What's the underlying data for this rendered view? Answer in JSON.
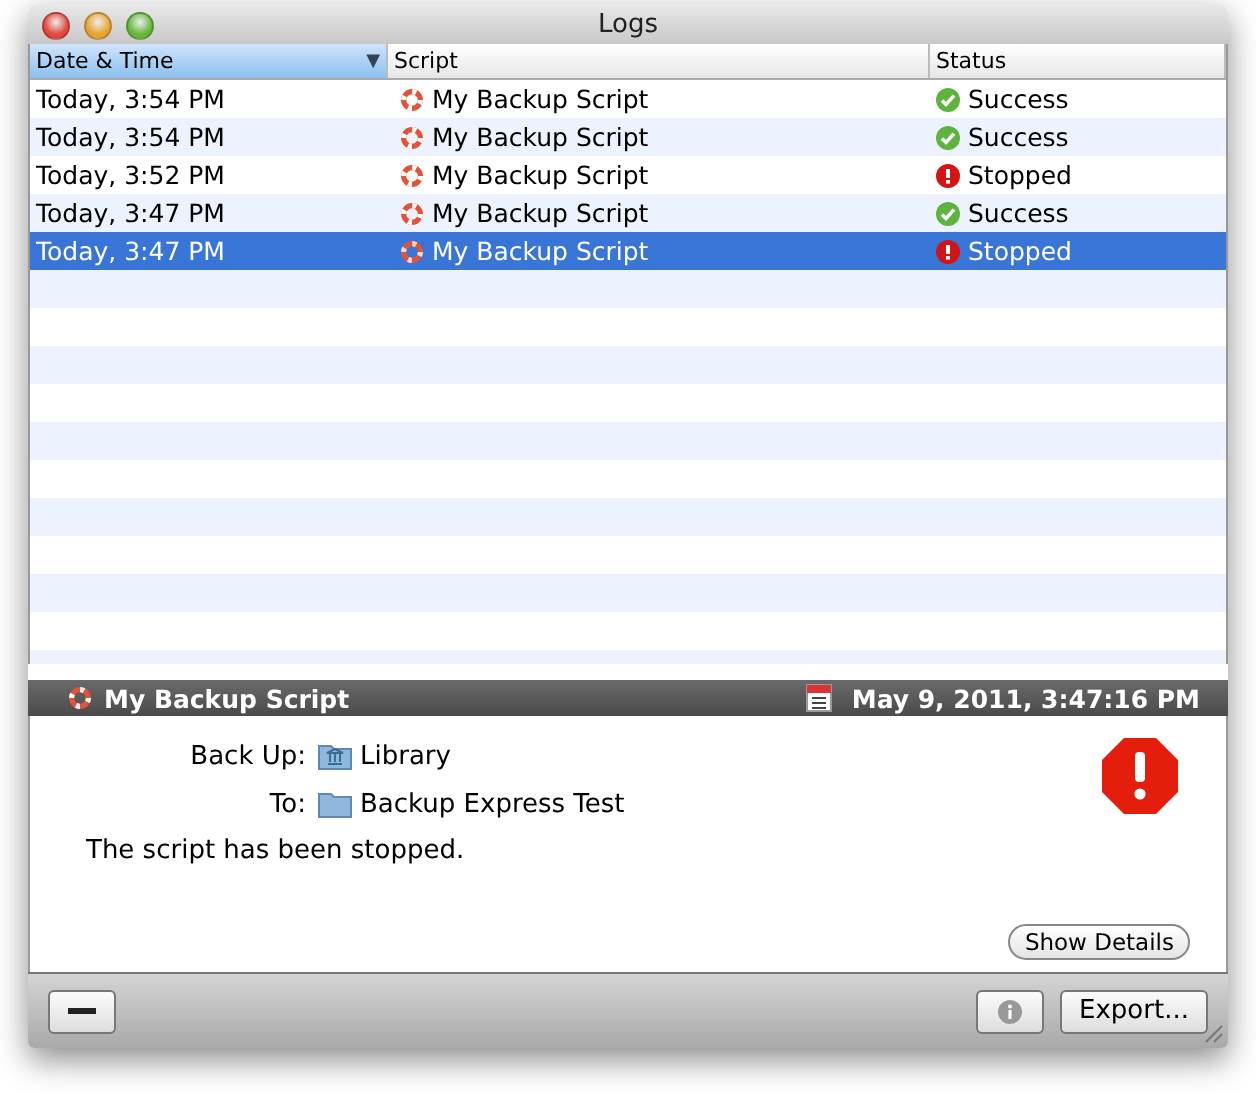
{
  "window": {
    "title": "Logs"
  },
  "columns": [
    {
      "label": "Date & Time",
      "selected": true,
      "sort_indicator": "▼"
    },
    {
      "label": "Script",
      "selected": false
    },
    {
      "label": "Status",
      "selected": false
    }
  ],
  "rows": [
    {
      "date": "Today, 3:54 PM",
      "script": "My Backup Script",
      "status": "Success",
      "kind": "success",
      "selected": false
    },
    {
      "date": "Today, 3:54 PM",
      "script": "My Backup Script",
      "status": "Success",
      "kind": "success",
      "selected": false
    },
    {
      "date": "Today, 3:52 PM",
      "script": "My Backup Script",
      "status": "Stopped",
      "kind": "stopped",
      "selected": false
    },
    {
      "date": "Today, 3:47 PM",
      "script": "My Backup Script",
      "status": "Success",
      "kind": "success",
      "selected": false
    },
    {
      "date": "Today, 3:47 PM",
      "script": "My Backup Script",
      "status": "Stopped",
      "kind": "stopped",
      "selected": true
    }
  ],
  "detail": {
    "script": "My Backup Script",
    "timestamp": "May 9, 2011, 3:47:16 PM",
    "kind": "stopped",
    "fields": [
      {
        "label": "Back Up:",
        "value": "Library",
        "kind": "library"
      },
      {
        "label": "To:",
        "value": "Backup Express Test",
        "kind": "folder"
      }
    ],
    "message": "The script has been stopped.",
    "details_button": "Show Details"
  },
  "footer": {
    "export_button": "Export..."
  }
}
